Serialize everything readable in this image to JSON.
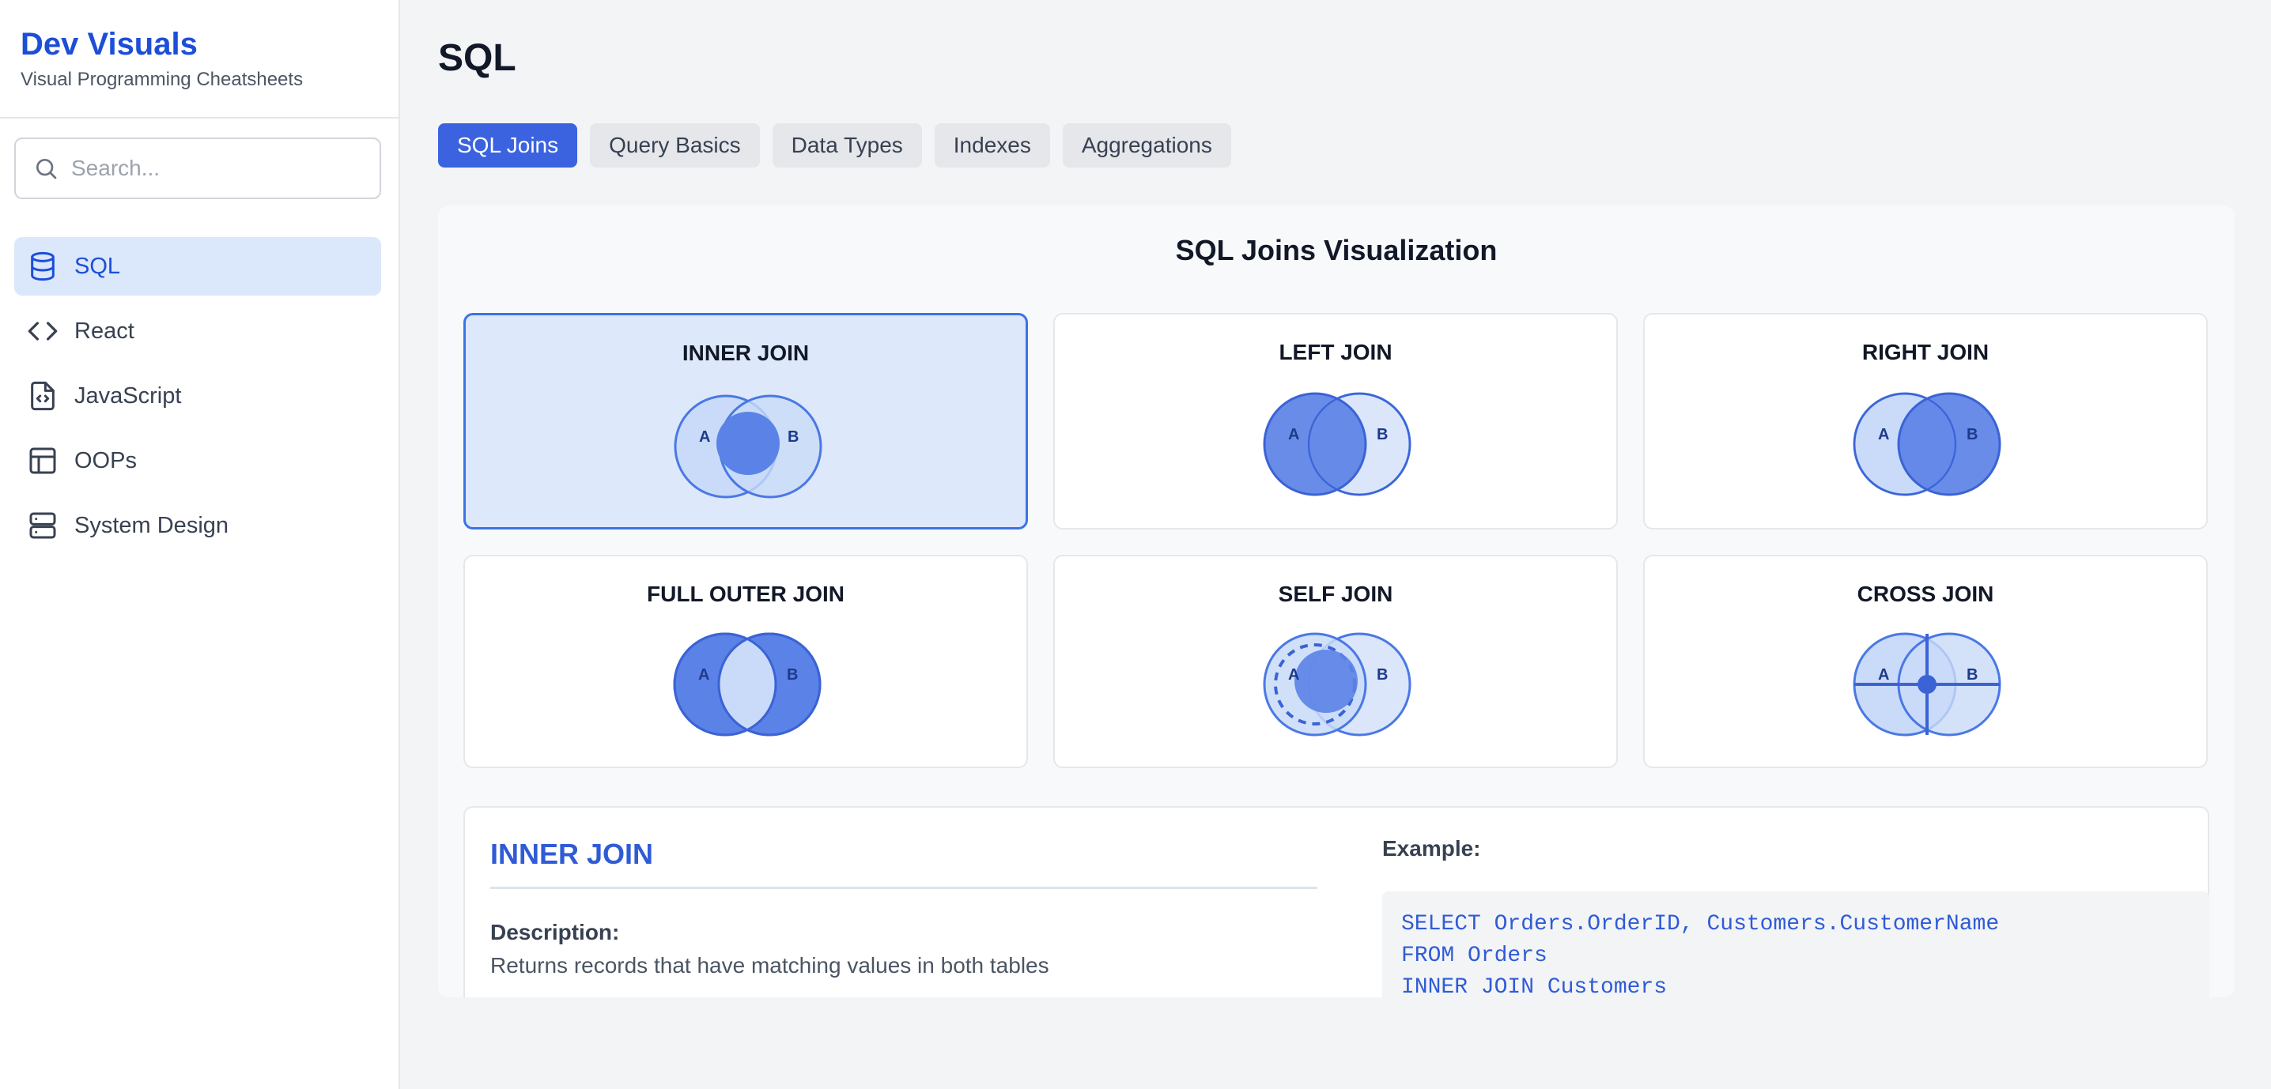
{
  "brand": {
    "title": "Dev Visuals",
    "subtitle": "Visual Programming Cheatsheets"
  },
  "search": {
    "placeholder": "Search..."
  },
  "nav": [
    {
      "label": "SQL",
      "icon": "database-icon",
      "active": true
    },
    {
      "label": "React",
      "icon": "code-icon",
      "active": false
    },
    {
      "label": "JavaScript",
      "icon": "file-code-icon",
      "active": false
    },
    {
      "label": "OOPs",
      "icon": "layout-icon",
      "active": false
    },
    {
      "label": "System Design",
      "icon": "server-icon",
      "active": false
    }
  ],
  "page": {
    "title": "SQL"
  },
  "tabs": [
    "SQL Joins",
    "Query Basics",
    "Data Types",
    "Indexes",
    "Aggregations"
  ],
  "panel": {
    "title": "SQL Joins Visualization"
  },
  "joins": [
    {
      "name": "INNER JOIN",
      "selected": true
    },
    {
      "name": "LEFT JOIN",
      "selected": false
    },
    {
      "name": "RIGHT JOIN",
      "selected": false
    },
    {
      "name": "FULL OUTER JOIN",
      "selected": false
    },
    {
      "name": "SELF JOIN",
      "selected": false
    },
    {
      "name": "CROSS JOIN",
      "selected": false
    }
  ],
  "venn_labels": {
    "a": "A",
    "b": "B"
  },
  "detail": {
    "title": "INNER JOIN",
    "description_label": "Description:",
    "description": "Returns records that have matching values in both tables",
    "example_label": "Example:",
    "code": [
      "SELECT Orders.OrderID, Customers.CustomerName",
      "FROM Orders",
      "INNER JOIN Customers"
    ]
  },
  "colors": {
    "accent": "#1d4ed8",
    "tab_active": "#3b63e0",
    "venn_fill": "#5b82e6",
    "venn_light": "#c9dbf8"
  }
}
